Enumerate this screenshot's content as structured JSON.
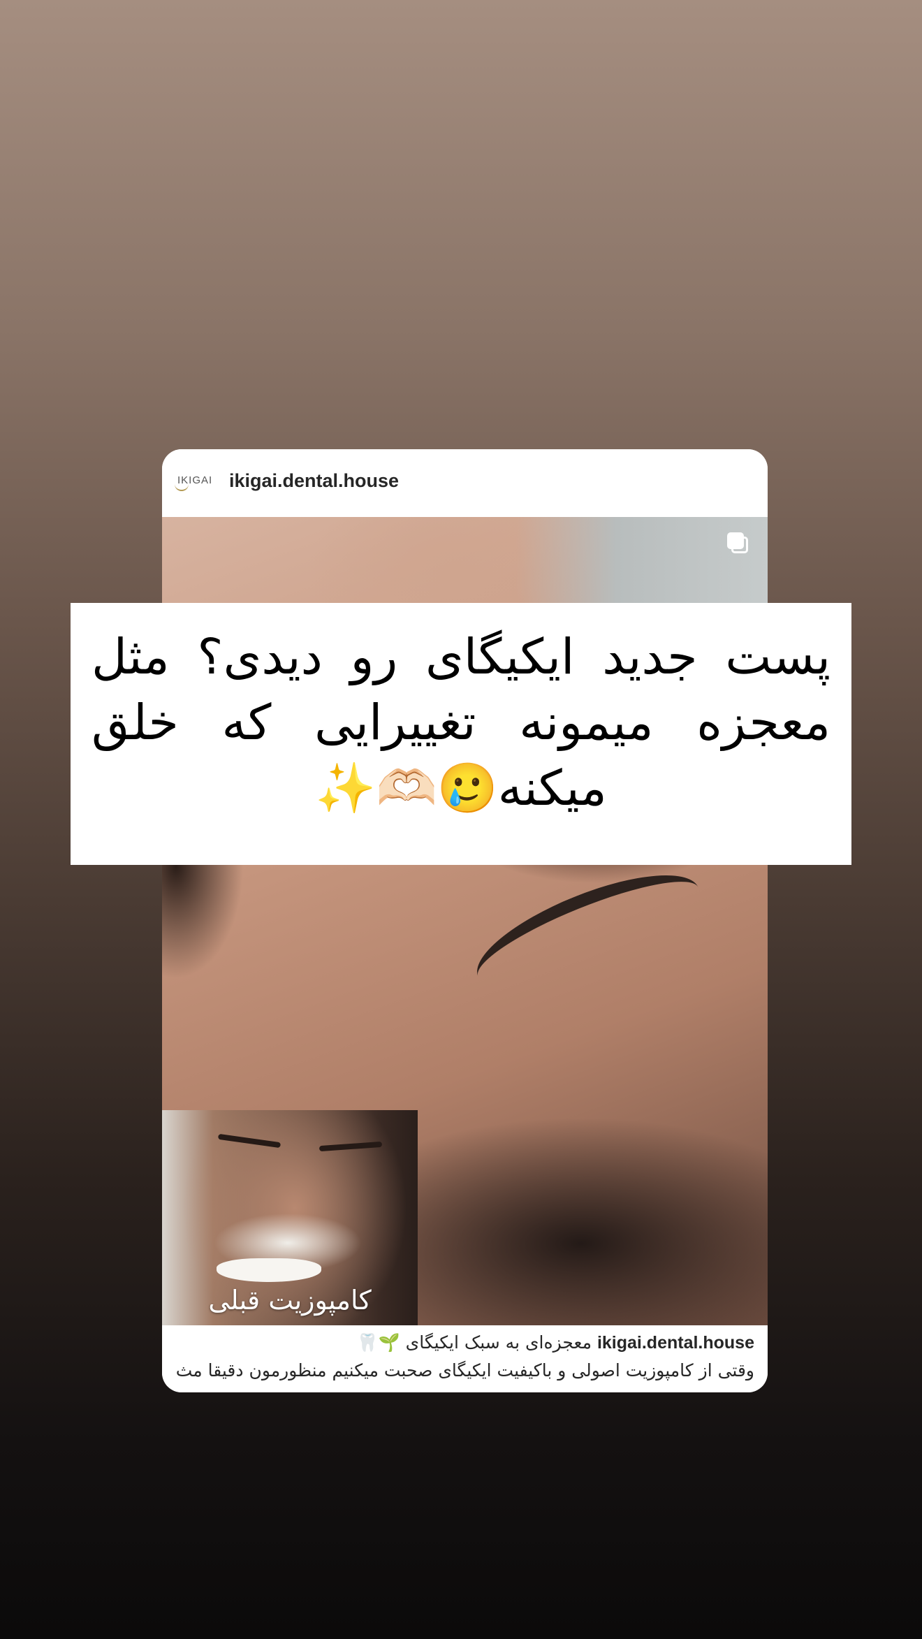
{
  "post": {
    "username": "ikigai.dental.house",
    "logo_text": "IKIGAI",
    "carousel_icon": "carousel-multiple-icon",
    "inset_caption": "کامپوزیت قبلی",
    "caption_user": "ikigai.dental.house",
    "caption_line1": "معجزه‌ای به سبک ایکیگای 🌱🦷",
    "caption_line2": "وقتی از کامپوزیت اصولی و باکیفیت ایکیگای صحبت میکنیم منظورمون دقیقا مث.."
  },
  "story": {
    "banner_text": "پست جدید ایکیگای رو دیدی؟ مثل معجزه میمونه تغییرایی که خلق میکنه🥲🫶🏻✨"
  },
  "colors": {
    "card_bg": "#ffffff",
    "username_color": "#262626",
    "banner_bg": "#ffffff"
  }
}
